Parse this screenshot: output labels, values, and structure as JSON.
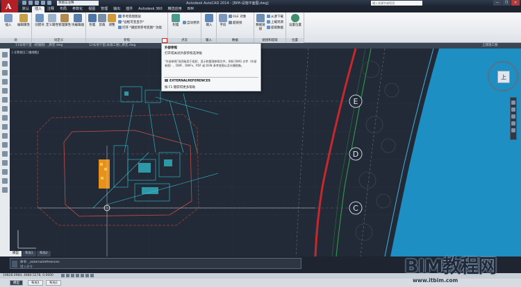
{
  "titlebar": {
    "workspace": "草图与注释",
    "window_title": "Autodesk AutoCAD 2014 - [BIM-设施平面图.dwg]",
    "search_placeholder": "键入关键字或短语",
    "controls": [
      "—",
      "❐",
      "✕"
    ]
  },
  "app_button": "A",
  "ribbon_tabs": [
    "默认",
    "插入",
    "注释",
    "布局",
    "参数化",
    "视图",
    "管理",
    "输出",
    "插件",
    "Autodesk 360",
    "精选应用",
    "BIM"
  ],
  "ribbon": {
    "panel_block": {
      "title": "块",
      "buttons": [
        "插入",
        "编辑属性"
      ]
    },
    "panel_blockdef": {
      "title": "块定义",
      "buttons": [
        "创建块",
        "定义属性",
        "管理属性",
        "块编辑器"
      ]
    },
    "panel_reference": {
      "title": "参照",
      "buttons": [
        "附着",
        "剪裁",
        "调整"
      ],
      "small": [
        "参考底图图层",
        "*边框可变显示*",
        "打开 *捕捉到参考底图* 功能"
      ]
    },
    "panel_pointcloud": {
      "title": "点云",
      "buttons": [
        "附着",
        "自动更新"
      ]
    },
    "panel_import": {
      "title": "输入",
      "buttons": [
        "输入"
      ]
    },
    "panel_data": {
      "title": "数据",
      "buttons": [
        "字段",
        "OLE 对象",
        "超链接"
      ]
    },
    "panel_linking": {
      "title": "链接和提取",
      "buttons": [
        "数据链接",
        "从源下载",
        "上载到源",
        "提取数据"
      ]
    },
    "panel_location": {
      "title": "位置",
      "buttons": [
        "设置位置"
      ]
    }
  },
  "doc_tabs": {
    "left_label": "11号地下室（结施图）_绑定.dwg",
    "mid_label": "12号地下室(总施工图)_绑定.dwg",
    "right_label": "土建施工图"
  },
  "viewport_label": "[-][俯视][二维线框]",
  "tooltip": {
    "title": "外部参照",
    "desc": "打开或关闭外部参照选项板",
    "body": "\"外部参照\"选项板用于组织、显示和管理参照文件，例如 DWG 文件（外部参照）、DWF、DWFx、PDF 或 DGN 参考底图以及光栅图像。",
    "command": "EXTERNALREFERENCES",
    "help": "按 F1 键获得更多帮助"
  },
  "viewcube": {
    "face": "上"
  },
  "grid_labels": [
    "E",
    "D",
    "C"
  ],
  "layout_tabs": [
    "模型",
    "布局1",
    "布局2"
  ],
  "cmdline": {
    "history": "命令: _externalreferences",
    "prompt": "键入命令"
  },
  "status": {
    "coords": "19828.0984, 4880.5278, 0.0000"
  },
  "bottom_tabs": [
    "模型",
    "布局1",
    "布局2"
  ],
  "watermark": {
    "text": "BIM教程网",
    "url": "www.itbim.com"
  },
  "colors": {
    "canvas": "#212a36",
    "water": "#1d8fc2",
    "red_line": "#c8282c",
    "green_line": "#2ea84a",
    "orange": "#e8901c",
    "cyan": "#33c7d6"
  }
}
